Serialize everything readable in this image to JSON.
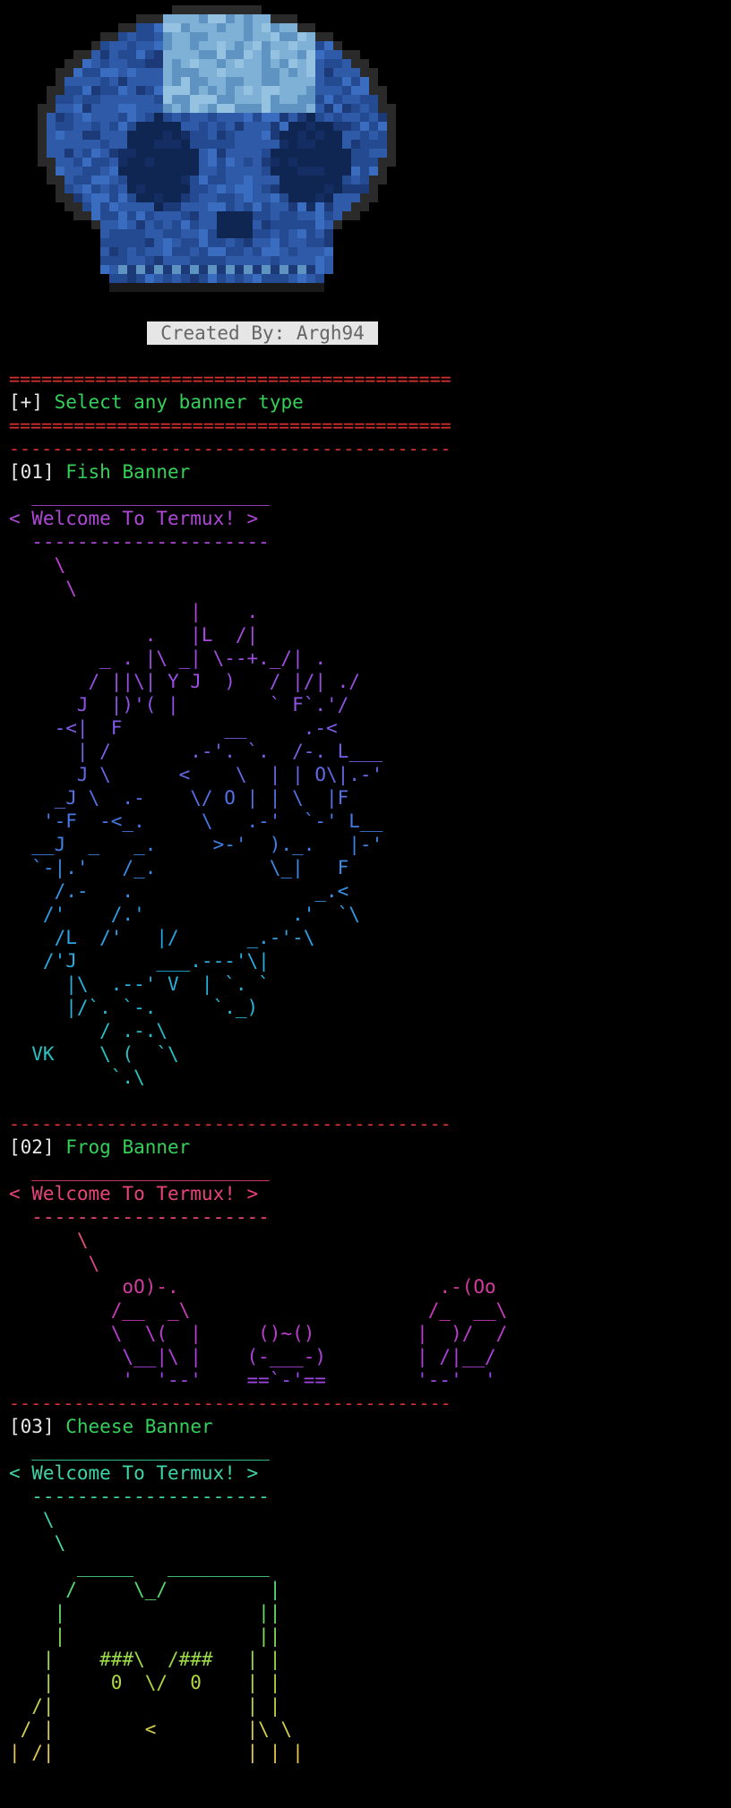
{
  "credit": "Created By: Argh94",
  "separator": "=========================================",
  "select_prompt_bracket_open": "[",
  "select_prompt_plus": "+",
  "select_prompt_bracket_close": "]",
  "select_prompt_text": " Select any banner type",
  "dash_separator": "-----------------------------------------",
  "banners": [
    {
      "num": "01",
      "name": "Fish Banner",
      "bubble_top": "  _____________________",
      "bubble_text": "< Welcome To Termux! >",
      "bubble_bottom": "  ---------------------",
      "art": [
        "    \\",
        "     \\",
        "                |    .",
        "            .   |L  /|",
        "        _ . |\\ _| \\--+._/| .",
        "       / ||\\| Y J  )   / |/| ./",
        "      J  |)'( |        ` F`.'/",
        "    -<|  F         __     .-<",
        "      | /       .-'. `.  /-. L___",
        "      J \\      <    \\  | | O\\|.-'",
        "    _J \\  .-    \\/ O | | \\  |F",
        "   '-F  -<_.     \\   .-'  `-' L__",
        "  __J  _   _.     >-'  )._.   |-'",
        "  `-|.'   /_.          \\_|   F",
        "    /.-   .                _.<",
        "   /'    /.'             .'  `\\",
        "    /L  /'   |/      _.-'-\\",
        "   /'J       ___.---'\\|",
        "     |\\  .--' V  | `. `",
        "     |/`. `-.     `._)",
        "        / .-.\\",
        "  VK    \\ (  `\\",
        "         `.\\"
      ]
    },
    {
      "num": "02",
      "name": "Frog Banner",
      "bubble_top": "  _____________________",
      "bubble_text": "< Welcome To Termux! >",
      "bubble_bottom": "  ---------------------",
      "art": [
        "      \\",
        "       \\",
        "          oO)-.                       .-(Oo",
        "         /__  _\\                     /_  __\\",
        "         \\  \\(  |     ()~()         |  )/  /",
        "          \\__|\\ |    (-___-)        | /|__/",
        "          '  '--'    ==`-'==        '--'  '"
      ]
    },
    {
      "num": "03",
      "name": "Cheese Banner",
      "bubble_top": "  _____________________",
      "bubble_text": "< Welcome To Termux! >",
      "bubble_bottom": "  ---------------------",
      "art": [
        "   \\",
        "    \\",
        "      _____   _________",
        "     /     \\_/         |",
        "    |                 ||",
        "    |                 ||",
        "   |    ###\\  /###   | |",
        "   |     0  \\/  0    | |",
        "  /|                 | |",
        " / |        <        |\\ \\",
        "| /|                 | | |"
      ]
    }
  ]
}
